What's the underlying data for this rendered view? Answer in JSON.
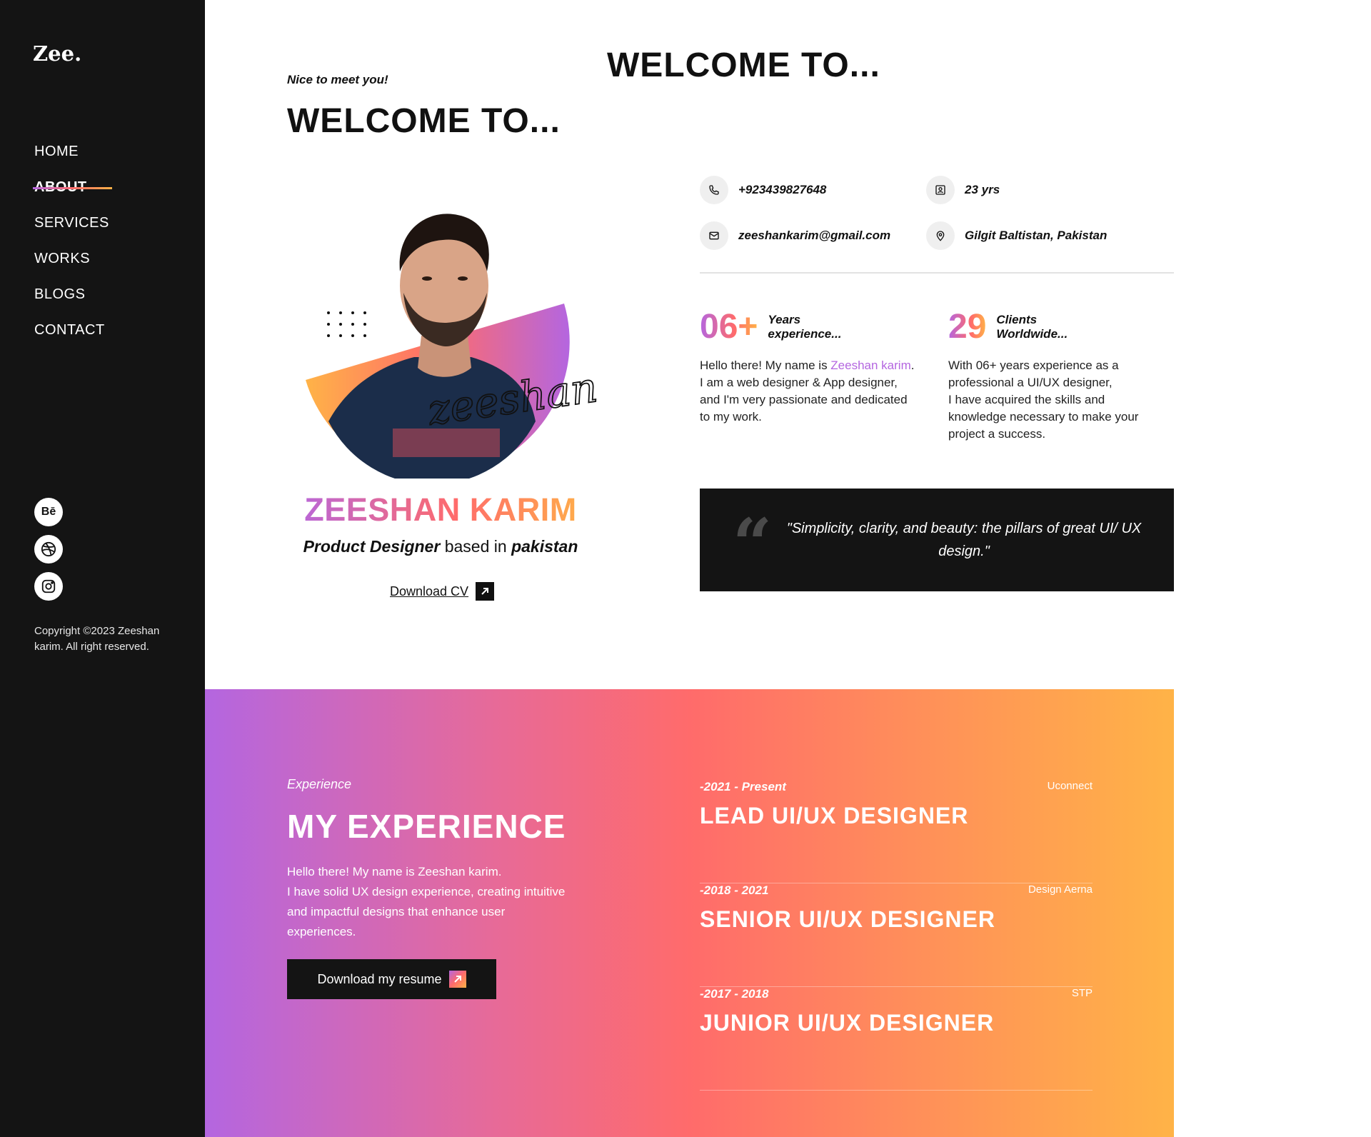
{
  "sidebar": {
    "logo": "Zee.",
    "nav": [
      {
        "label": "HOME"
      },
      {
        "label": "ABOUT"
      },
      {
        "label": "SERVICES"
      },
      {
        "label": "WORKS"
      },
      {
        "label": "BLOGS"
      },
      {
        "label": "CONTACT"
      }
    ],
    "active_item": "ABOUT",
    "social_icons": [
      "behance-icon",
      "dribbble-icon",
      "instagram-icon"
    ],
    "copyright": "Copyright ©2023 Zeeshan karim. All right reserved."
  },
  "header": {
    "big_title": "WELCOME TO...",
    "kicker": "Nice to meet you!",
    "title": "WELCOME TO..."
  },
  "profile": {
    "signature": "zeeshan",
    "name": "ZEESHAN KARIM",
    "role_bold": "Product Designer",
    "role_mid": "based in",
    "role_place": "pakistan",
    "download_cv": "Download CV"
  },
  "contact": {
    "phone": "+923439827648",
    "age": "23 yrs",
    "email": "zeeshankarim@gmail.com",
    "location": "Gilgit Baltistan, Pakistan"
  },
  "stats": [
    {
      "number": "06+",
      "label_line1": "Years",
      "label_line2": "experience..."
    },
    {
      "number": "29",
      "label_line1": "Clients",
      "label_line2": "Worldwide..."
    }
  ],
  "bio": {
    "p1_before": "Hello there! My name is ",
    "p1_highlight": "Zeeshan karim",
    "p1_after": ".",
    "p1_line2": "I am a web designer & App designer,",
    "p1_line3": "and I'm very passionate and dedicated",
    "p1_line4": "to my work.",
    "p2_line1": "With 06+ years experience as a",
    "p2_line2": "professional a UI/UX designer,",
    "p2_line3": "I have acquired the skills and",
    "p2_line4": "knowledge necessary to make your",
    "p2_line5": "project a success."
  },
  "quote": {
    "mark": "“",
    "text": "\"Simplicity, clarity, and beauty: the pillars of great UI/ UX design.\""
  },
  "experience": {
    "kicker": "Experience",
    "title": "MY EXPERIENCE",
    "desc_line1": "Hello there! My name is Zeeshan karim.",
    "desc_line2": "I have solid UX design experience, creating intuitive",
    "desc_line3": "and impactful designs that enhance user",
    "desc_line4": "experiences.",
    "resume_button": "Download my resume",
    "jobs": [
      {
        "period": "-2021 - Present",
        "company": "Uconnect",
        "title": "LEAD UI/UX DESIGNER"
      },
      {
        "period": "-2018 - 2021",
        "company": "Design Aerna",
        "title": "SENIOR UI/UX DESIGNER"
      },
      {
        "period": "-2017 - 2018",
        "company": "STP",
        "title": "JUNIOR UI/UX DESIGNER"
      }
    ]
  },
  "colors": {
    "sidebar_bg": "#141414",
    "gradient_start": "#b466e0",
    "gradient_mid": "#ff6b6b",
    "gradient_end": "#ffb347"
  }
}
